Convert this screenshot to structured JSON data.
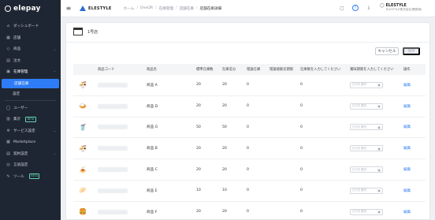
{
  "sidebar": {
    "logo": "elepay",
    "items": [
      {
        "label": "ダッシュボード",
        "icon": "dashboard-icon",
        "glyph": "⌂"
      },
      {
        "label": "店舗",
        "icon": "store-icon",
        "glyph": "▦"
      },
      {
        "label": "商品",
        "icon": "tag-icon",
        "glyph": "◇",
        "chevron": "⌄"
      },
      {
        "label": "注文",
        "icon": "order-icon",
        "glyph": "▤"
      },
      {
        "label": "在庫管理",
        "icon": "inventory-icon",
        "glyph": "▣",
        "chevron": "⌃"
      }
    ],
    "sub_items": [
      {
        "label": "店舗在庫"
      },
      {
        "label": "設定"
      }
    ],
    "items2": [
      {
        "label": "ユーザー",
        "icon": "user-icon",
        "glyph": "◯"
      },
      {
        "label": "集計",
        "icon": "chart-icon",
        "glyph": "▥",
        "badge": "BETA"
      },
      {
        "label": "サービス設定",
        "icon": "gear-icon",
        "glyph": "✲",
        "chevron": "⌄"
      },
      {
        "label": "Marketplace",
        "icon": "marketplace-icon",
        "glyph": "▦"
      },
      {
        "label": "契約設定",
        "icon": "contract-icon",
        "glyph": "▤",
        "chevron": "⌄"
      },
      {
        "label": "言語設定",
        "icon": "language-icon",
        "glyph": "◎"
      },
      {
        "label": "ツール",
        "icon": "tool-icon",
        "glyph": "✎",
        "badge": "BETA"
      }
    ]
  },
  "header": {
    "brand": "ELESTYLE",
    "breadcrumb": [
      "ホーム",
      "OneQR",
      "在庫管理",
      "店舗在庫",
      "店舗在庫詳細"
    ],
    "user_name": "ELESTYLE",
    "user_org": "ELESTYLE株式会社(開発用)"
  },
  "store": {
    "name": "1号店"
  },
  "buttons": {
    "cancel": "キャンセル",
    "save": "保存"
  },
  "table": {
    "headers": {
      "code": "商品コード",
      "name": "商品名",
      "standard": "標準在庫数",
      "diff": "在庫差分",
      "theoretical": "理論在庫",
      "limit": "理論値販売期限",
      "input": "在庫数を入力してください",
      "date": "賞味期限を入力してください",
      "ops": "操作"
    },
    "date_placeholder": "日付を選択",
    "edit_label": "編集",
    "rows": [
      {
        "name": "商品 A",
        "standard": "20",
        "diff": "20",
        "theoretical": "0",
        "input": "0",
        "icon": "bowl-icon",
        "glyph": "🍜"
      },
      {
        "name": "商品 D",
        "standard": "20",
        "diff": "20",
        "theoretical": "0",
        "input": "0",
        "icon": "dish-icon",
        "glyph": "🍛"
      },
      {
        "name": "商品 G",
        "standard": "50",
        "diff": "50",
        "theoretical": "0",
        "input": "0",
        "icon": "drink-icon",
        "glyph": "🥤"
      },
      {
        "name": "商品 B",
        "standard": "20",
        "diff": "20",
        "theoretical": "0",
        "input": "0",
        "icon": "bowl-icon",
        "glyph": "🍜"
      },
      {
        "name": "商品 C",
        "standard": "20",
        "diff": "20",
        "theoretical": "0",
        "input": "0",
        "icon": "noodle-icon",
        "glyph": "🍝"
      },
      {
        "name": "商品 E",
        "standard": "10",
        "diff": "10",
        "theoretical": "0",
        "input": "0",
        "icon": "snack-icon",
        "glyph": "🥟"
      },
      {
        "name": "商品 F",
        "standard": "20",
        "diff": "20",
        "theoretical": "0",
        "input": "0",
        "icon": "burger-icon",
        "glyph": "🍔"
      }
    ]
  }
}
